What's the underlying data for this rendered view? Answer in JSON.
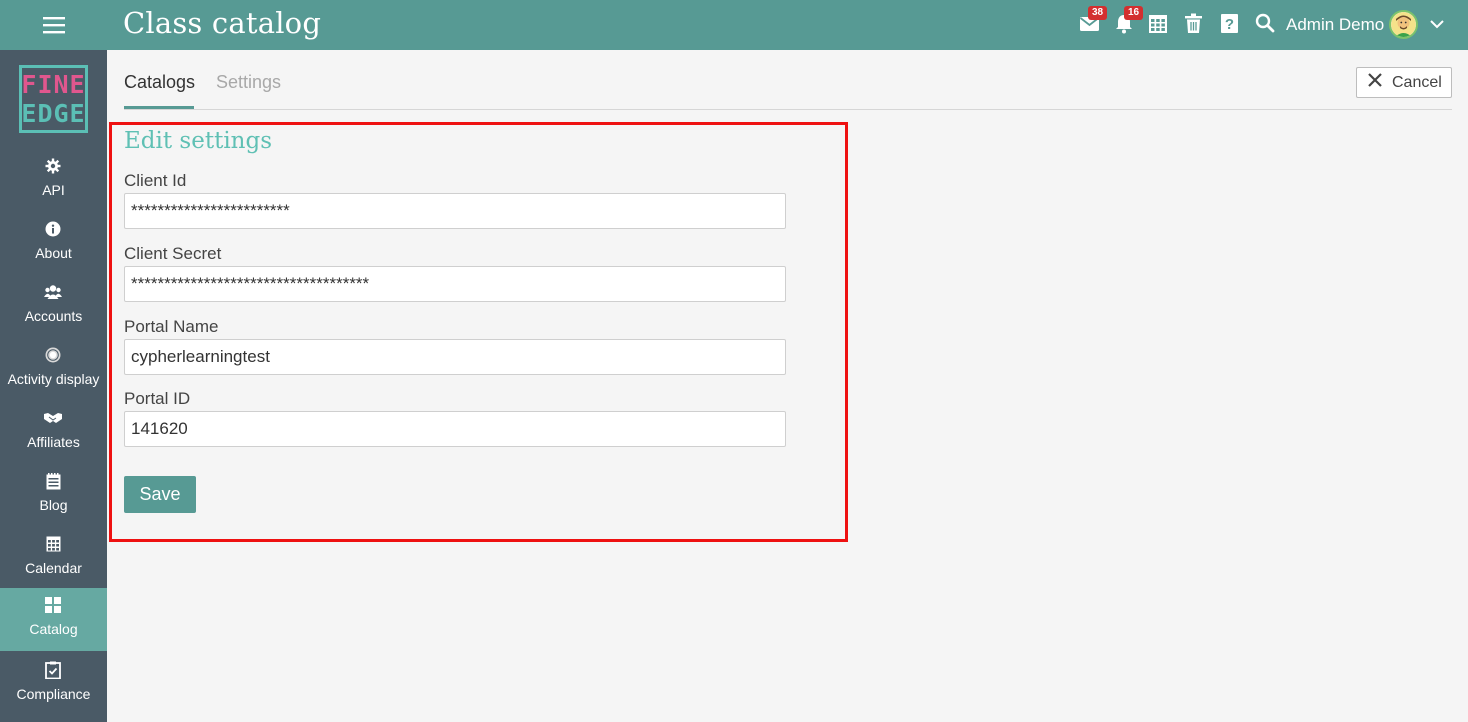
{
  "header": {
    "title": "Class catalog",
    "user_name": "Admin Demo",
    "mail_badge": "38",
    "notif_badge": "16",
    "icons": [
      "menu-icon",
      "mail-icon",
      "bell-icon",
      "calendar-icon",
      "trash-icon",
      "help-icon",
      "search-icon",
      "avatar",
      "chevron-down-icon"
    ]
  },
  "sidebar": {
    "logo_line1": "FINE",
    "logo_line2": "EDGE",
    "items": [
      {
        "label": "API",
        "icon": "gear-icon"
      },
      {
        "label": "About",
        "icon": "info-icon"
      },
      {
        "label": "Accounts",
        "icon": "users-icon"
      },
      {
        "label": "Activity display",
        "icon": "dot-circle-icon"
      },
      {
        "label": "Affiliates",
        "icon": "handshake-icon"
      },
      {
        "label": "Blog",
        "icon": "blog-icon"
      },
      {
        "label": "Calendar",
        "icon": "calendar-icon"
      },
      {
        "label": "Catalog",
        "icon": "grid-icon",
        "active": true
      },
      {
        "label": "Compliance",
        "icon": "clipboard-check-icon"
      }
    ]
  },
  "tabs": {
    "catalogs": "Catalogs",
    "settings": "Settings",
    "active": "Catalogs"
  },
  "cancel_label": "Cancel",
  "form": {
    "title": "Edit settings",
    "fields": [
      {
        "label": "Client Id",
        "value": "************************"
      },
      {
        "label": "Client Secret",
        "value": "************************************"
      },
      {
        "label": "Portal Name",
        "value": "cypherlearningtest"
      },
      {
        "label": "Portal ID",
        "value": "141620"
      }
    ],
    "save_label": "Save"
  },
  "colors": {
    "header_bg": "#579a94",
    "sidebar_bg": "#4a5a66",
    "sidebar_active": "#66a9a2",
    "accent_title": "#5fc0b4",
    "highlight_border": "#ee1111",
    "badge": "#d32f2f"
  }
}
